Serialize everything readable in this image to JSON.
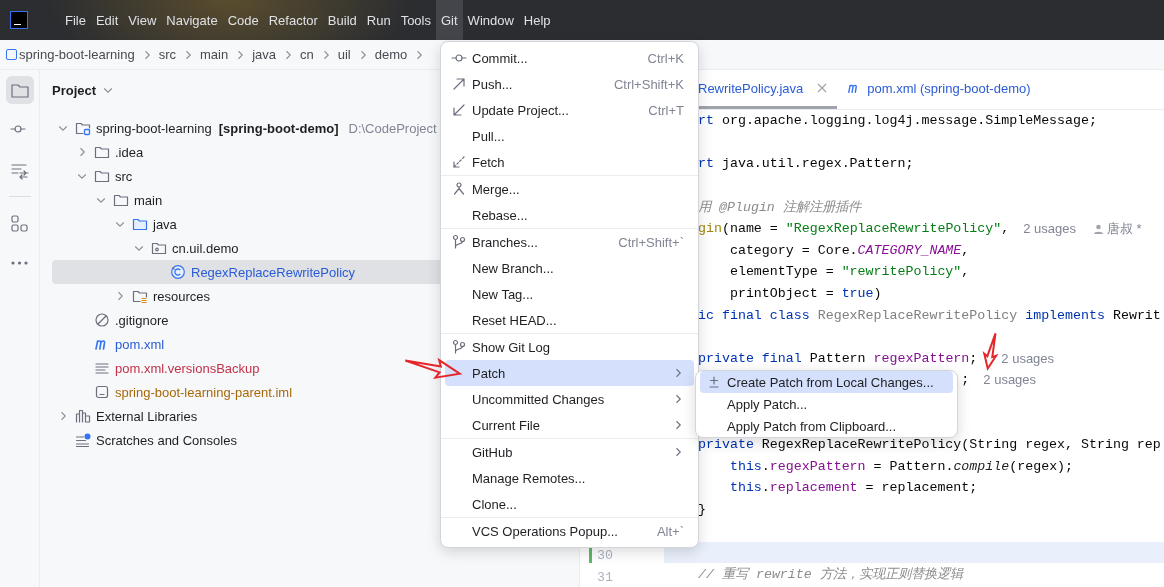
{
  "menubar": {
    "items": [
      {
        "label": "File",
        "selected": false
      },
      {
        "label": "Edit",
        "selected": false
      },
      {
        "label": "View",
        "selected": false
      },
      {
        "label": "Navigate",
        "selected": false
      },
      {
        "label": "Code",
        "selected": false
      },
      {
        "label": "Refactor",
        "selected": false
      },
      {
        "label": "Build",
        "selected": false
      },
      {
        "label": "Run",
        "selected": false
      },
      {
        "label": "Tools",
        "selected": false
      },
      {
        "label": "Git",
        "selected": true
      },
      {
        "label": "Window",
        "selected": false
      },
      {
        "label": "Help",
        "selected": false
      }
    ]
  },
  "breadcrumbs": [
    "spring-boot-learning",
    "src",
    "main",
    "java",
    "cn",
    "uil",
    "demo"
  ],
  "toolstrip": {
    "items": [
      {
        "kind": "project",
        "selected": true
      },
      {
        "kind": "commit",
        "selected": false
      },
      {
        "kind": "pull-requests",
        "selected": false
      },
      {
        "kind": "structure",
        "selected": false
      },
      {
        "kind": "more",
        "selected": false
      }
    ]
  },
  "project_panel": {
    "title": "Project",
    "tree": [
      {
        "label": "spring-boot-learning",
        "module": "[spring-boot-demo]",
        "path": "D:\\CodeProject",
        "kind": "module",
        "expanded": true,
        "selected": false,
        "children": [
          {
            "label": ".idea",
            "kind": "folder",
            "expanded": false,
            "selected": false
          },
          {
            "label": "src",
            "kind": "folder",
            "expanded": true,
            "selected": false,
            "children": [
              {
                "label": "main",
                "kind": "folder",
                "expanded": true,
                "selected": false,
                "children": [
                  {
                    "label": "java",
                    "kind": "source-folder",
                    "expanded": true,
                    "selected": false,
                    "children": [
                      {
                        "label": "cn.uil.demo",
                        "kind": "package",
                        "expanded": true,
                        "selected": false,
                        "children": [
                          {
                            "label": "RegexReplaceRewritePolicy",
                            "kind": "class",
                            "color": "#2a5bd7",
                            "selected": true
                          }
                        ]
                      }
                    ]
                  },
                  {
                    "label": "resources",
                    "kind": "resources-folder",
                    "expanded": false,
                    "selected": false
                  }
                ]
              }
            ]
          },
          {
            "label": ".gitignore",
            "kind": "ignore",
            "selected": false
          },
          {
            "label": "pom.xml",
            "kind": "maven",
            "color": "#2a5bd7",
            "selected": false
          },
          {
            "label": "pom.xml.versionsBackup",
            "kind": "text-file",
            "color": "#c3324a",
            "selected": false
          },
          {
            "label": "spring-boot-learning-parent.iml",
            "kind": "iml",
            "color": "#a8680a",
            "selected": false
          }
        ]
      },
      {
        "label": "External Libraries",
        "kind": "libraries",
        "expanded": false,
        "selected": false
      },
      {
        "label": "Scratches and Consoles",
        "kind": "scratches",
        "selected": false
      }
    ]
  },
  "editor": {
    "tabs": [
      {
        "label": "RewritePolicy.java",
        "selected": true,
        "closable": true
      },
      {
        "label": "pom.xml (spring-boot-demo)",
        "kind": "maven",
        "selected": false,
        "closable": false
      }
    ],
    "lines": [
      {
        "current": false,
        "tokens": [
          {
            "kind": "keyword",
            "text": "rt"
          },
          {
            "kind": "plain",
            "text": " org.apache.logging.log4j.message.SimpleMessage;"
          }
        ]
      },
      {
        "current": false
      },
      {
        "current": false,
        "tokens": [
          {
            "kind": "keyword",
            "text": "rt"
          },
          {
            "kind": "plain",
            "text": " java.util.regex.Pattern;"
          }
        ]
      },
      {
        "current": false
      },
      {
        "current": false,
        "tokens": [
          {
            "kind": "comment",
            "text": "用 @Plugin 注解注册插件"
          }
        ]
      },
      {
        "current": false,
        "tokens": [
          {
            "kind": "annotation",
            "text": "gin"
          },
          {
            "kind": "plain",
            "text": "(name = "
          },
          {
            "kind": "string",
            "text": "\"RegexReplaceRewritePolicy\""
          },
          {
            "kind": "plain",
            "text": ","
          },
          {
            "kind": "hint",
            "text": "2 usages"
          },
          {
            "kind": "author",
            "text": "唐叔 *"
          }
        ]
      },
      {
        "current": false,
        "tokens": [
          {
            "kind": "plain",
            "text": "    category = Core."
          },
          {
            "kind": "constant",
            "text": "CATEGORY_NAME"
          },
          {
            "kind": "plain",
            "text": ","
          }
        ]
      },
      {
        "current": false,
        "tokens": [
          {
            "kind": "plain",
            "text": "    elementType = "
          },
          {
            "kind": "string",
            "text": "\"rewritePolicy\""
          },
          {
            "kind": "plain",
            "text": ","
          }
        ]
      },
      {
        "current": false,
        "tokens": [
          {
            "kind": "plain",
            "text": "    printObject = "
          },
          {
            "kind": "keyword",
            "text": "true"
          },
          {
            "kind": "plain",
            "text": ")"
          }
        ]
      },
      {
        "current": false,
        "tokens": [
          {
            "kind": "keyword",
            "text": "ic final class"
          },
          {
            "kind": "muted",
            "text": " RegexReplaceRewritePolicy"
          },
          {
            "kind": "keyword",
            "text": " implements"
          },
          {
            "kind": "plain",
            "text": " Rewrit"
          }
        ]
      },
      {
        "current": false
      },
      {
        "current": false,
        "tokens": [
          {
            "kind": "keyword",
            "text": "private final"
          },
          {
            "kind": "plain",
            "text": " Pattern "
          },
          {
            "kind": "field",
            "text": "regexPattern"
          },
          {
            "kind": "plain",
            "text": ";"
          },
          {
            "kind": "hint",
            "text": "2 usages"
          }
        ]
      },
      {
        "current": false,
        "tokens": [
          {
            "kind": "plain",
            "text": "                                 ;"
          },
          {
            "kind": "hint",
            "text": "2 usages"
          }
        ]
      },
      {
        "current": false
      },
      {
        "current": false
      },
      {
        "current": false,
        "tokens": [
          {
            "kind": "keyword",
            "text": "private"
          },
          {
            "kind": "plain",
            "text": " RegexReplaceRewritePolicy(String regex, String rep"
          }
        ]
      },
      {
        "current": false,
        "tokens": [
          {
            "kind": "keyword",
            "text": "    this"
          },
          {
            "kind": "plain",
            "text": "."
          },
          {
            "kind": "field",
            "text": "regexPattern"
          },
          {
            "kind": "plain",
            "text": " = Pattern."
          },
          {
            "kind": "static-call",
            "text": "compile"
          },
          {
            "kind": "plain",
            "text": "(regex);"
          }
        ]
      },
      {
        "current": false,
        "tokens": [
          {
            "kind": "keyword",
            "text": "    this"
          },
          {
            "kind": "plain",
            "text": "."
          },
          {
            "kind": "field",
            "text": "replacement"
          },
          {
            "kind": "plain",
            "text": " = replacement;"
          }
        ]
      },
      {
        "current": false,
        "tokens": [
          {
            "kind": "plain",
            "text": "}"
          }
        ]
      },
      {
        "current": false
      },
      {
        "current": true,
        "number": "30",
        "changed": true
      },
      {
        "current": false,
        "number": "31",
        "changed": false,
        "tokens": [
          {
            "kind": "comment",
            "text": "// 重写 rewrite 方法，实现正则替换逻辑"
          }
        ]
      }
    ]
  },
  "git_menu": {
    "groups": [
      [
        {
          "label": "Commit...",
          "shortcut": "Ctrl+K",
          "kind": "commit",
          "selected": false,
          "submenu": false
        },
        {
          "label": "Push...",
          "shortcut": "Ctrl+Shift+K",
          "kind": "push",
          "selected": false,
          "submenu": false
        },
        {
          "label": "Update Project...",
          "shortcut": "Ctrl+T",
          "kind": "update",
          "selected": false,
          "submenu": false
        },
        {
          "label": "Pull...",
          "selected": false,
          "submenu": false
        },
        {
          "label": "Fetch",
          "kind": "fetch",
          "selected": false,
          "submenu": false
        }
      ],
      [
        {
          "label": "Merge...",
          "kind": "merge",
          "selected": false,
          "submenu": false
        },
        {
          "label": "Rebase...",
          "selected": false,
          "submenu": false
        }
      ],
      [
        {
          "label": "Branches...",
          "shortcut": "Ctrl+Shift+`",
          "kind": "branch",
          "selected": false,
          "submenu": false
        },
        {
          "label": "New Branch...",
          "selected": false,
          "submenu": false
        },
        {
          "label": "New Tag...",
          "selected": false,
          "submenu": false
        },
        {
          "label": "Reset HEAD...",
          "selected": false,
          "submenu": false
        }
      ],
      [
        {
          "label": "Show Git Log",
          "kind": "branch",
          "selected": false,
          "submenu": false
        },
        {
          "label": "Patch",
          "selected": true,
          "submenu": true
        },
        {
          "label": "Uncommitted Changes",
          "selected": false,
          "submenu": true
        },
        {
          "label": "Current File",
          "selected": false,
          "submenu": true
        }
      ],
      [
        {
          "label": "GitHub",
          "selected": false,
          "submenu": true
        },
        {
          "label": "Manage Remotes...",
          "selected": false,
          "submenu": false
        },
        {
          "label": "Clone...",
          "selected": false,
          "submenu": false
        }
      ],
      [
        {
          "label": "VCS Operations Popup...",
          "shortcut": "Alt+`",
          "selected": false,
          "submenu": false
        }
      ]
    ],
    "open_submenu": {
      "items": [
        {
          "label": "Create Patch from Local Changes...",
          "kind": "plus-minus",
          "selected": true
        },
        {
          "label": "Apply Patch...",
          "selected": false
        },
        {
          "label": "Apply Patch from Clipboard...",
          "selected": false
        }
      ]
    }
  }
}
